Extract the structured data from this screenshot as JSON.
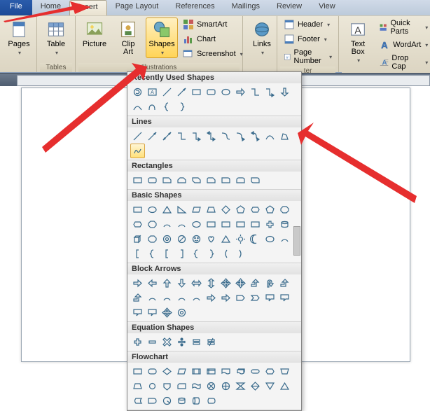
{
  "tabs": {
    "file": "File",
    "home": "Home",
    "insert": "Insert",
    "pagelayout": "Page Layout",
    "references": "References",
    "mailings": "Mailings",
    "review": "Review",
    "view": "View"
  },
  "groups": {
    "pages": {
      "label": "",
      "pages": "Pages"
    },
    "tables": {
      "label": "Tables",
      "table": "Table"
    },
    "illustrations": {
      "label": "Illustrations",
      "picture": "Picture",
      "clipart": "Clip\nArt",
      "shapes": "Shapes",
      "smartart": "SmartArt",
      "chart": "Chart",
      "screenshot": "Screenshot"
    },
    "links": {
      "label": "",
      "links": "Links"
    },
    "headerfooter": {
      "label": "ter",
      "header": "Header",
      "footer": "Footer",
      "pagenumber": "Page Number"
    },
    "text": {
      "label": "",
      "textbox": "Text\nBox",
      "quickparts": "Quick Parts",
      "wordart": "WordArt",
      "dropcap": "Drop Cap"
    }
  },
  "gallery": {
    "recent": "Recently Used Shapes",
    "lines": "Lines",
    "rectangles": "Rectangles",
    "basic": "Basic Shapes",
    "block": "Block Arrows",
    "equation": "Equation Shapes",
    "flowchart": "Flowchart"
  }
}
